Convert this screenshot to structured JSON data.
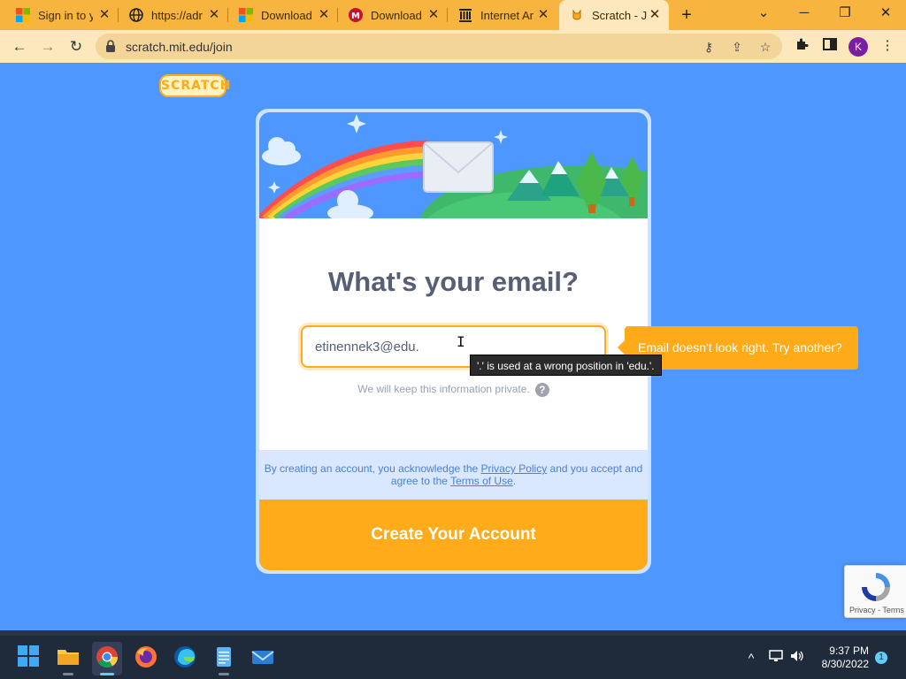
{
  "browser": {
    "tabs": [
      {
        "title": "Sign in to y",
        "icon": "microsoft-icon"
      },
      {
        "title": "https://adr",
        "icon": "globe-icon"
      },
      {
        "title": "Download",
        "icon": "microsoft-icon"
      },
      {
        "title": "Download",
        "icon": "mcafee-icon"
      },
      {
        "title": "Internet Ar",
        "icon": "archive-icon"
      },
      {
        "title": "Scratch - Jo",
        "icon": "scratch-cat-icon",
        "active": true
      }
    ],
    "url": "scratch.mit.edu/join",
    "profile_initial": "K",
    "theme_color": "#f7b53f"
  },
  "page": {
    "logo_text": "SCRATCH",
    "title": "What's your email?",
    "email_value": "etinennek3@edu.",
    "validation_tooltip": "'.' is used at a wrong position in 'edu.'.",
    "error_message": "Email doesn't look right. Try another?",
    "privacy_note": "We will keep this information private.",
    "legal": {
      "prefix": "By creating an account, you acknowledge the ",
      "privacy_link": "Privacy Policy",
      "middle": " and you accept and agree to the ",
      "terms_link": "Terms of Use",
      "suffix": "."
    },
    "create_button": "Create Your Account",
    "recaptcha_label": "Privacy - Terms",
    "accent_color": "#ffab19",
    "background_color": "#4d97ff"
  },
  "taskbar": {
    "apps": [
      "start-icon",
      "file-explorer-icon",
      "chrome-icon",
      "firefox-icon",
      "edge-icon",
      "notepad-icon",
      "mail-icon"
    ],
    "time": "9:37 PM",
    "date": "8/30/2022",
    "notification_count": "1"
  }
}
